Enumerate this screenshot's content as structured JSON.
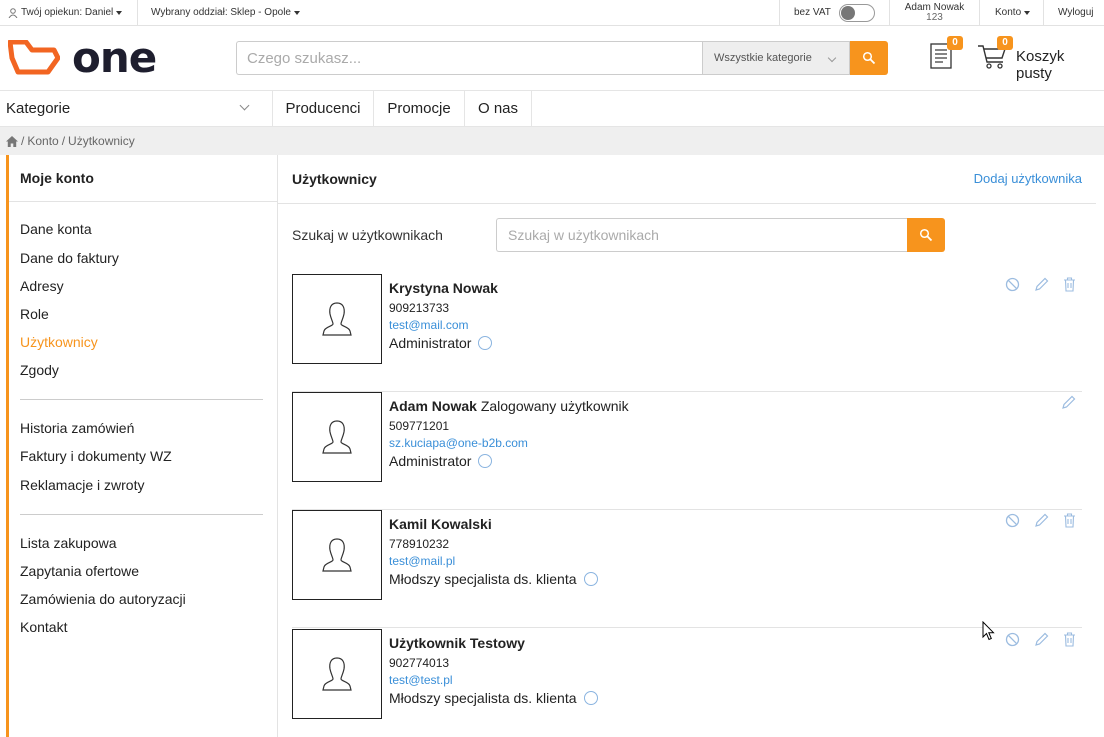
{
  "topbar": {
    "caretaker": "Twój opiekun: Daniel",
    "branch": "Wybrany oddział: Sklep - Opole",
    "vat_label": "bez VAT",
    "user_name": "Adam Nowak",
    "user_id": "123",
    "account": "Konto",
    "logout": "Wyloguj"
  },
  "header": {
    "logo_text": "one",
    "search_placeholder": "Czego szukasz...",
    "category_select": "Wszystkie kategorie",
    "docs_count": "0",
    "cart_count": "0",
    "cart_label": "Koszyk pusty"
  },
  "nav": {
    "categories": "Kategorie",
    "links": [
      "Producenci",
      "Promocje",
      "O nas"
    ]
  },
  "breadcrumb": {
    "items": [
      "Konto",
      "Użytkownicy"
    ],
    "separator": "/"
  },
  "sidebar": {
    "title": "Moje konto",
    "groups": [
      [
        "Dane konta",
        "Dane do faktury",
        "Adresy",
        "Role",
        "Użytkownicy",
        "Zgody"
      ],
      [
        "Historia zamówień",
        "Faktury i dokumenty WZ",
        "Reklamacje i zwroty"
      ],
      [
        "Lista zakupowa",
        "Zapytania ofertowe",
        "Zamówienia do autoryzacji",
        "Kontakt"
      ]
    ],
    "active": "Użytkownicy"
  },
  "main": {
    "title": "Użytkownicy",
    "add_user": "Dodaj użytkownika",
    "filter_label": "Szukaj w użytkownikach",
    "filter_placeholder": "Szukaj w użytkownikach"
  },
  "users": [
    {
      "name": "Krystyna Nowak",
      "note": "",
      "phone": "909213733",
      "email": "test@mail.com",
      "role": "Administrator",
      "actions": [
        "block",
        "edit",
        "delete"
      ]
    },
    {
      "name": "Adam Nowak",
      "note": "Zalogowany użytkownik",
      "phone": "509771201",
      "email": "sz.kuciapa@one-b2b.com",
      "role": "Administrator",
      "actions": [
        "edit"
      ]
    },
    {
      "name": "Kamil Kowalski",
      "note": "",
      "phone": "778910232",
      "email": "test@mail.pl",
      "role": "Młodszy specjalista ds. klienta",
      "actions": [
        "block",
        "edit",
        "delete"
      ]
    },
    {
      "name": "Użytkownik Testowy",
      "note": "",
      "phone": "902774013",
      "email": "test@test.pl",
      "role": "Młodszy specjalista ds. klienta",
      "actions": [
        "block",
        "edit",
        "delete"
      ]
    }
  ],
  "colors": {
    "accent": "#f7941d",
    "link": "#3a8fd8",
    "icon_muted": "#9cbce0"
  },
  "icons": {
    "user": "user-icon",
    "search": "search-icon",
    "docs": "document-list-icon",
    "cart": "cart-icon",
    "home": "home-icon",
    "block": "block-icon",
    "edit": "pencil-icon",
    "delete": "trash-icon",
    "info": "info-icon",
    "avatar": "person-silhouette-icon"
  }
}
